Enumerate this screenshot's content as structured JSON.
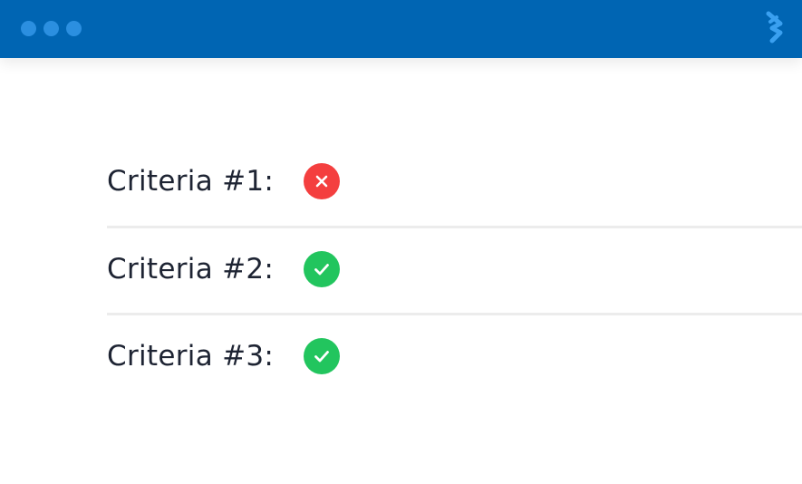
{
  "window": {
    "title_bar_color": "#0065b3",
    "controls": [
      {
        "name": "window-dot"
      },
      {
        "name": "window-dot"
      },
      {
        "name": "window-dot"
      }
    ],
    "logo_icon": "brand-logo-icon"
  },
  "criteria": [
    {
      "label": "Criteria #1:",
      "status": "fail",
      "status_icon": "x-icon",
      "color": "#f43f3f"
    },
    {
      "label": "Criteria #2:",
      "status": "pass",
      "status_icon": "check-icon",
      "color": "#22c55e"
    },
    {
      "label": "Criteria #3:",
      "status": "pass",
      "status_icon": "check-icon",
      "color": "#22c55e"
    }
  ]
}
